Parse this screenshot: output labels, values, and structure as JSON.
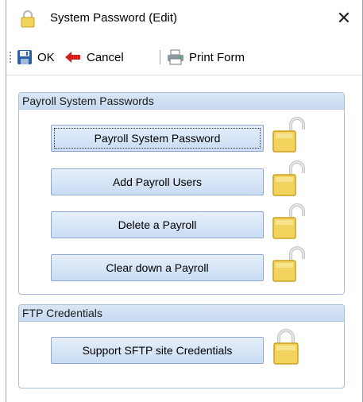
{
  "window": {
    "title": "System Password  (Edit)"
  },
  "toolbar": {
    "ok_label": "OK",
    "cancel_label": "Cancel",
    "print_label": "Print Form"
  },
  "groups": {
    "payroll": {
      "title": "Payroll System Passwords",
      "buttons": [
        {
          "label": "Payroll System Password",
          "lock_state": "unlocked"
        },
        {
          "label": "Add Payroll Users",
          "lock_state": "unlocked"
        },
        {
          "label": "Delete a Payroll",
          "lock_state": "unlocked"
        },
        {
          "label": "Clear down a Payroll",
          "lock_state": "unlocked"
        }
      ]
    },
    "ftp": {
      "title": "FTP Credentials",
      "buttons": [
        {
          "label": "Support SFTP site Credentials",
          "lock_state": "locked"
        }
      ]
    }
  },
  "colors": {
    "lock_body": "#f2d35e",
    "lock_shackle": "#c8c8c8",
    "button_top": "#e6effa",
    "button_bottom": "#c9dcf3",
    "group_border": "#a9bfdc"
  },
  "icons": {
    "title": "padlock-icon",
    "ok": "save-icon",
    "cancel": "back-arrow-icon",
    "print": "print-icon",
    "close": "close-icon"
  }
}
